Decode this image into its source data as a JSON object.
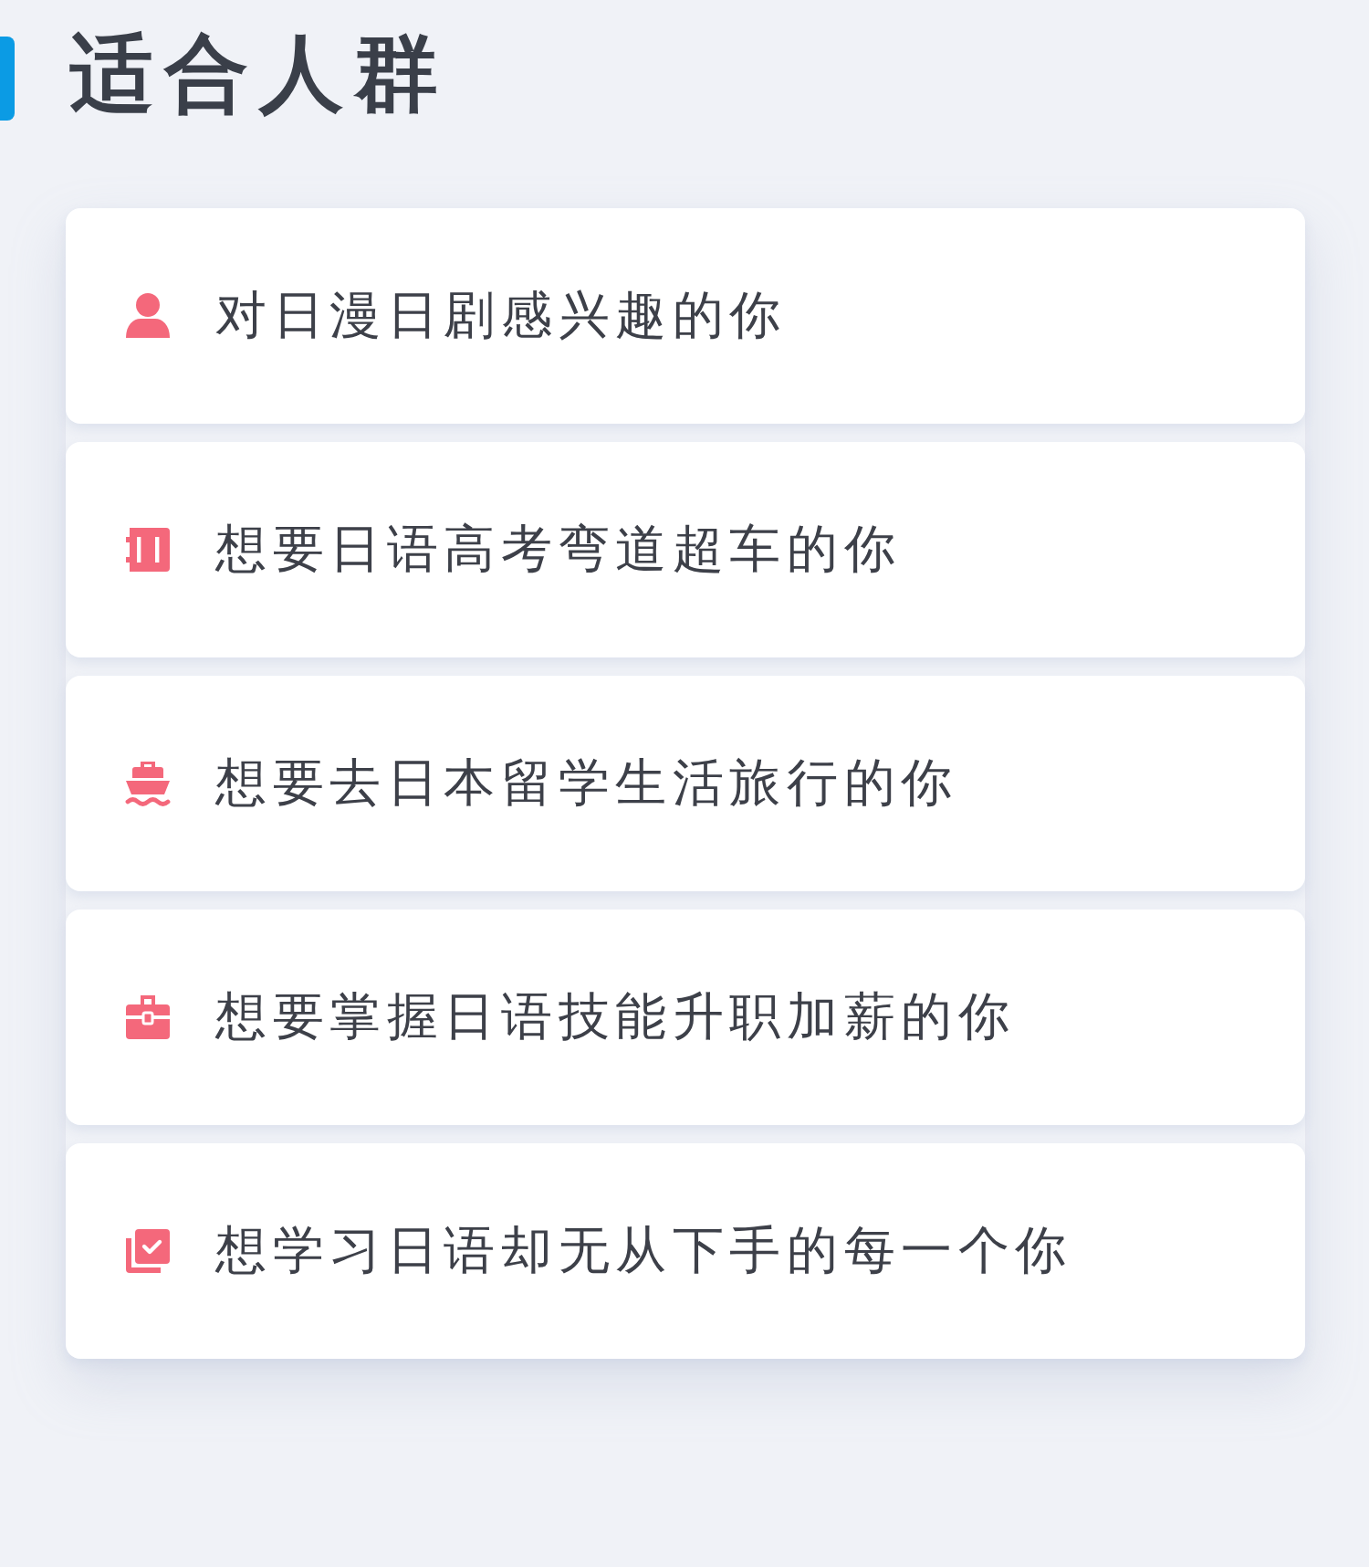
{
  "section": {
    "title": "适合人群"
  },
  "audience": [
    {
      "text": "对日漫日剧感兴趣的你"
    },
    {
      "text": "想要日语高考弯道超车的你"
    },
    {
      "text": "想要去日本留学生活旅行的你"
    },
    {
      "text": "想要掌握日语技能升职加薪的你"
    },
    {
      "text": "想学习日语却无从下手的每一个你"
    }
  ]
}
